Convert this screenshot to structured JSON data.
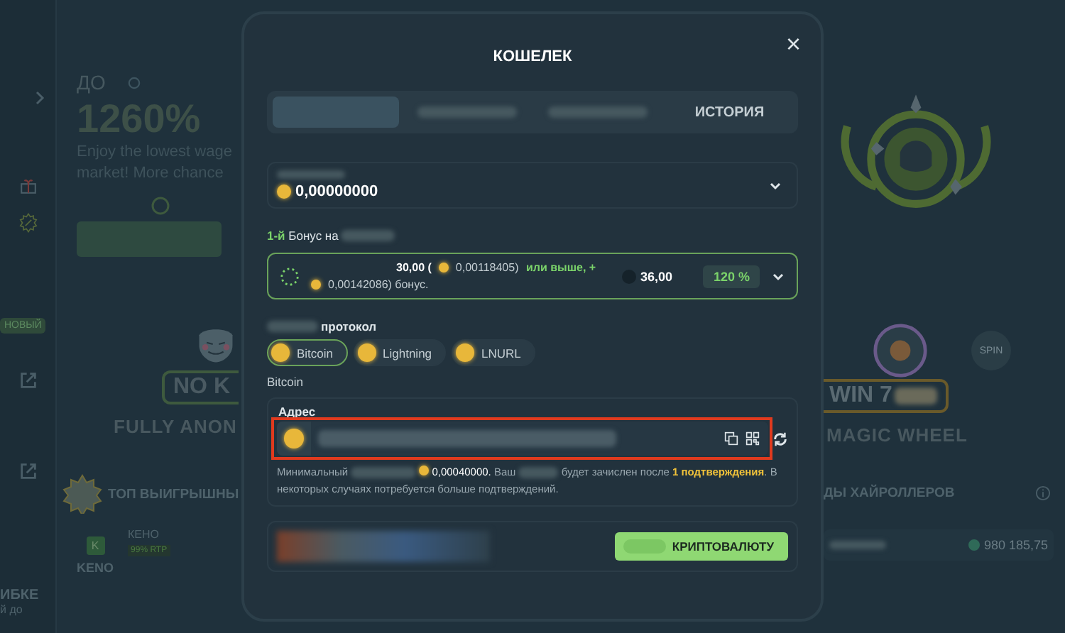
{
  "sidebar": {
    "badge": "НОВЫЙ",
    "bottom_lines": [
      "ИБКЕ",
      "й до"
    ]
  },
  "promo": {
    "prefix": "ДО",
    "headline": "1260%",
    "lines": [
      "Enjoy the lowest wage",
      "market! More chance"
    ]
  },
  "feature_left": {
    "badge": "NO K",
    "caption": "FULLY ANON"
  },
  "feature_right": {
    "badge": "WIN 7",
    "caption": "MAGIC WHEEL",
    "spin": "SPIN"
  },
  "top_wins": {
    "title": "ТОП ВЫИГРЫШНЫ",
    "game_icon": "K",
    "game": "КЕНО",
    "rtp": "99% RTP",
    "game_label": "KENO"
  },
  "highrollers": {
    "title": "ДЫ ХАЙРОЛЛЕРОВ",
    "amount": "980 185,75"
  },
  "modal": {
    "title": "КОШЕЛЕК",
    "close": "×",
    "tabs": [
      {
        "selected": true
      },
      {
        "selected": false
      },
      {
        "selected": false
      },
      {
        "label": "ИСТОРИЯ",
        "selected": false
      }
    ],
    "balance": "0,00000000",
    "bonus_heading": {
      "accent": "1-й",
      "text": "Бонус на"
    },
    "bonus": {
      "amount": "30,00 (",
      "min_crypto": "0,00118405)",
      "or_more": "или выше, +",
      "bonus_crypto": "0,00142086) бонус.",
      "target": "36,00",
      "percent": "120 %",
      "selected": true
    },
    "protocol_label": "протокол",
    "protocols": [
      {
        "label": "Bitcoin",
        "selected": true
      },
      {
        "label": "Lightning",
        "selected": false
      },
      {
        "label": "LNURL",
        "selected": false
      }
    ],
    "network": "Bitcoin",
    "address_label": "Адрес",
    "note_parts": [
      "Минимальный",
      "0,00040000. Ваш",
      "будет зачислен после **1 подтверждения**. В некоторых случаях потребуется больше подтверждений."
    ],
    "submit": "КРИПТОВАЛЮТУ"
  }
}
